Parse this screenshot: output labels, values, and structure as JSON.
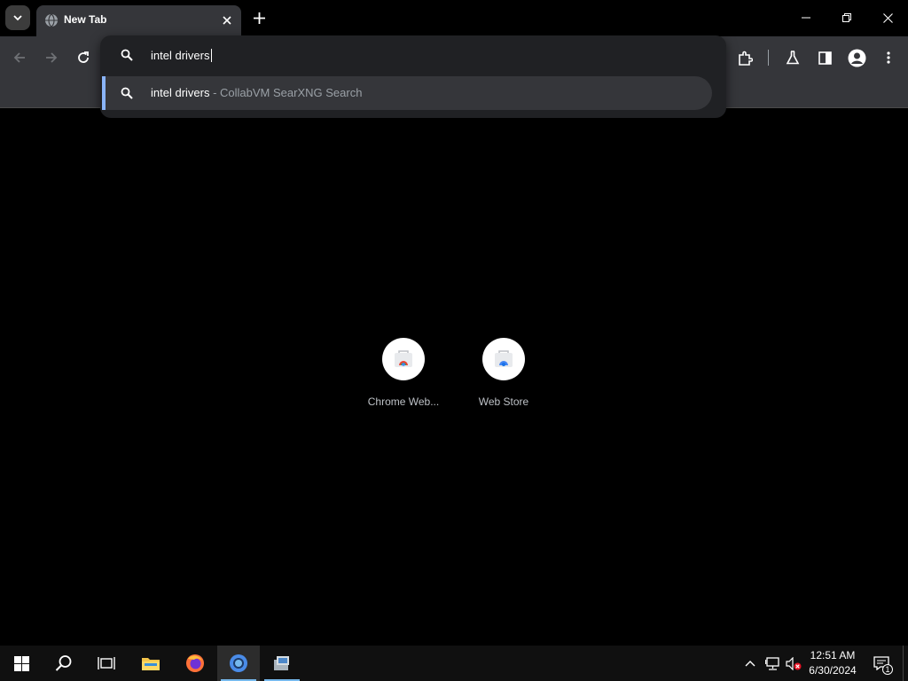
{
  "tab": {
    "title": "New Tab"
  },
  "omnibox": {
    "value": "intel drivers",
    "suggestion": {
      "query": "intel drivers",
      "engine": " - CollabVM SearXNG Search"
    }
  },
  "shortcuts": [
    {
      "label": "Chrome Web..."
    },
    {
      "label": "Web Store"
    }
  ],
  "taskbar": {
    "time": "12:51 AM",
    "date": "6/30/2024",
    "notification_count": "1"
  },
  "icons": {
    "tab_search": "chevron-down-icon",
    "favicon": "globe-icon",
    "tab_close": "close-icon",
    "new_tab": "plus-icon",
    "minimize": "minimize-icon",
    "restore": "restore-icon",
    "close": "close-icon",
    "back": "arrow-left-icon",
    "forward": "arrow-right-icon",
    "reload": "reload-icon",
    "extensions": "puzzle-icon",
    "labs": "flask-icon",
    "side_panel": "side-panel-icon",
    "profile": "profile-icon",
    "menu": "kebab-menu-icon"
  },
  "colors": {
    "accent": "#8ab4f8",
    "taskbar_accent": "#76b9ed",
    "toolbar_bg": "#35363a",
    "omnibox_bg": "#202124"
  }
}
